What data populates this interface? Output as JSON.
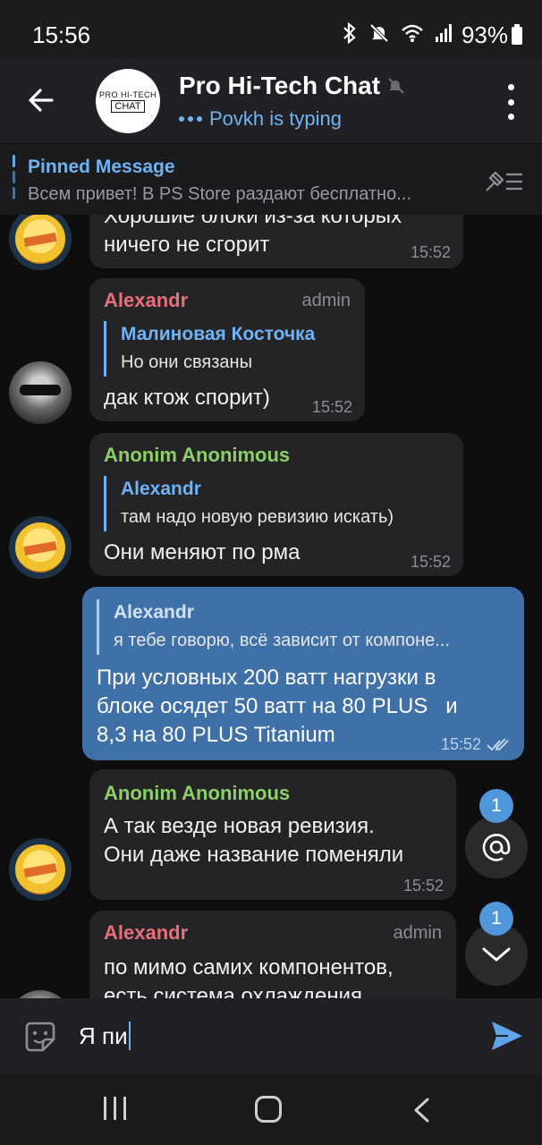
{
  "status_bar": {
    "time": "15:56",
    "battery": "93%"
  },
  "header": {
    "avatar_line1": "PRO HI-TECH",
    "avatar_line2": "CHAT",
    "title": "Pro Hi-Tech Chat",
    "subtitle": "Povkh is typing"
  },
  "pinned": {
    "title": "Pinned Message",
    "text": "Всем привет! В PS Store раздают бесплатно..."
  },
  "messages": [
    {
      "text": "Хорошие блоки из-за которых\nничего не сгорит",
      "time": "15:52"
    },
    {
      "sender": "Alexandr",
      "role": "admin",
      "reply_name": "Малиновая Косточка",
      "reply_text": "Но они связаны",
      "text": "дак ктож спорит)",
      "time": "15:52"
    },
    {
      "sender": "Anonim Anonimous",
      "reply_name": "Alexandr",
      "reply_text": "там надо новую ревизию искать)",
      "text": "Они меняют по рма",
      "time": "15:52"
    },
    {
      "reply_name": "Alexandr",
      "reply_text": "я тебе говорю, всё зависит от компоне...",
      "text": "При условных 200 ватт нагрузки в\nблоке осядет 50 ватт на 80 PLUS   и\n8,3 на 80 PLUS Titanium",
      "time": "15:52"
    },
    {
      "sender": "Anonim Anonimous",
      "text": "А так везде новая ревизия.\nОни даже название поменяли",
      "time": "15:52"
    },
    {
      "sender": "Alexandr",
      "role": "admin",
      "text": "по мимо самих компонентов,\nесть система охлаждения"
    }
  ],
  "fab": {
    "mentions_count": "1",
    "scroll_count": "1"
  },
  "input": {
    "value": "Я пи"
  },
  "colors": {
    "accent": "#6fb3f4",
    "outgoing_bubble": "#3f70a8",
    "incoming_bubble": "#242426",
    "admin_name": "#e86f7a",
    "member_name": "#8ccf66"
  }
}
